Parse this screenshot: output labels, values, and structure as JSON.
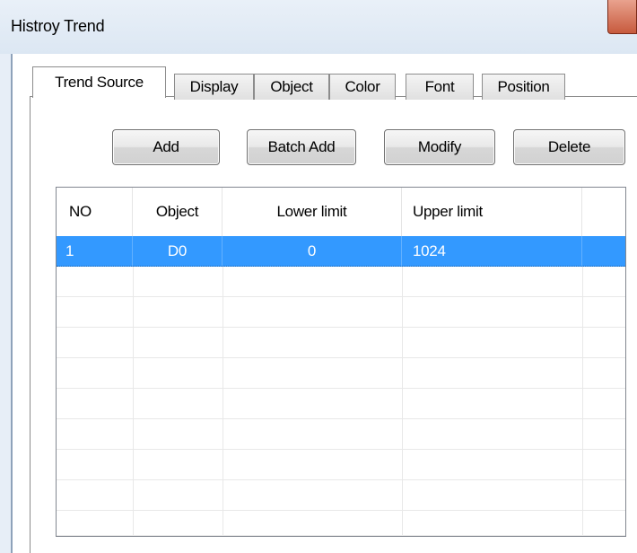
{
  "window": {
    "title": "Histroy Trend"
  },
  "tabs": [
    {
      "label": "Trend Source",
      "active": true
    },
    {
      "label": "Display",
      "active": false
    },
    {
      "label": "Object",
      "active": false
    },
    {
      "label": "Color",
      "active": false
    },
    {
      "label": "Font",
      "active": false
    },
    {
      "label": "Position",
      "active": false
    }
  ],
  "buttons": {
    "add": "Add",
    "batch_add": "Batch Add",
    "modify": "Modify",
    "delete": "Delete"
  },
  "table": {
    "columns": [
      "NO",
      "Object",
      "Lower limit",
      "Upper limit"
    ],
    "rows": [
      {
        "no": "1",
        "object": "D0",
        "lower": "0",
        "upper": "1024",
        "selected": true
      }
    ],
    "empty_rows": 9
  },
  "colors": {
    "selection": "#3399ff",
    "close_button": "#c75a3d"
  }
}
